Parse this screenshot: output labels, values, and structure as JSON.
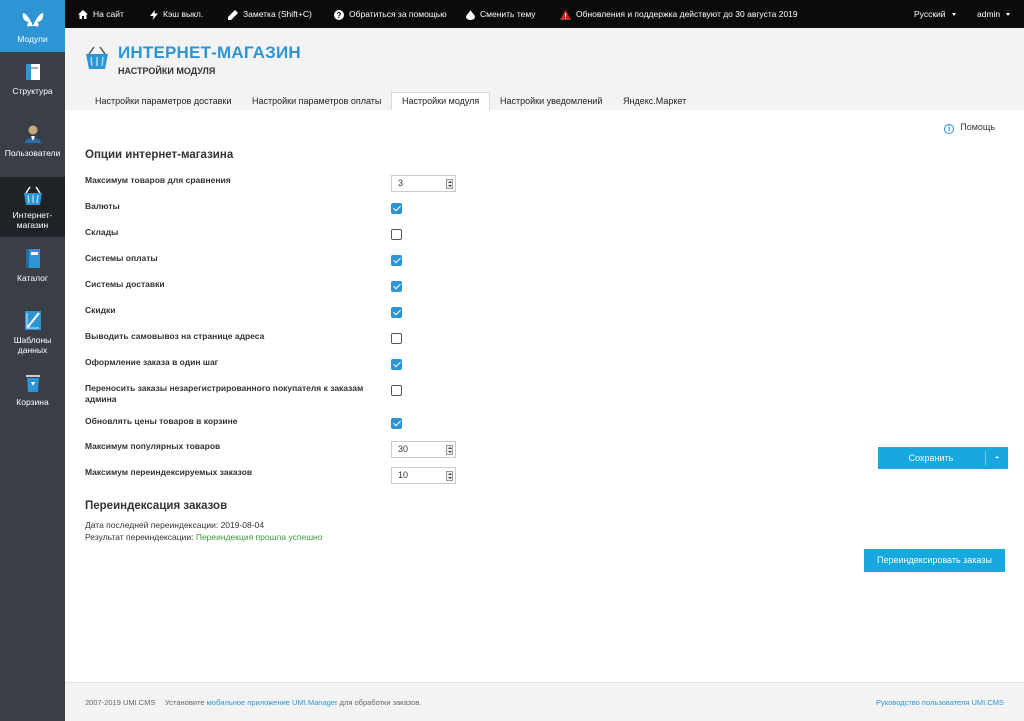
{
  "sidebar": {
    "items": [
      {
        "label": "Модули",
        "icon": "butterfly-icon"
      },
      {
        "label": "Структура",
        "icon": "structure-icon"
      },
      {
        "label": "Пользователи",
        "icon": "users-icon"
      },
      {
        "label": "Интернет-магазин",
        "icon": "shop-basket-icon"
      },
      {
        "label": "Каталог",
        "icon": "catalog-book-icon"
      },
      {
        "label": "Шаблоны данных",
        "icon": "data-templates-icon"
      },
      {
        "label": "Корзина",
        "icon": "trash-bin-icon"
      }
    ]
  },
  "topbar": {
    "site": "На сайт",
    "cache": "Кэш выкл.",
    "note": "Заметка (Shift+C)",
    "help": "Обратиться за помощью",
    "theme": "Сменить тему",
    "updates": "Обновления и поддержка действуют до 30 августа 2019",
    "language": "Русский",
    "user": "admin"
  },
  "header": {
    "title": "ИНТЕРНЕТ-МАГАЗИН",
    "subtitle": "НАСТРОЙКИ МОДУЛЯ"
  },
  "tabs": [
    {
      "label": "Настройки параметров доставки",
      "active": false
    },
    {
      "label": "Настройки параметров оплаты",
      "active": false
    },
    {
      "label": "Настройки модуля",
      "active": true
    },
    {
      "label": "Настройки уведомлений",
      "active": false
    },
    {
      "label": "Яндекс.Маркет",
      "active": false
    }
  ],
  "help_label": "Помощь",
  "options": {
    "title": "Опции интернет-магазина",
    "max_compare": {
      "label": "Максимум товаров для сравнения",
      "value": "3"
    },
    "currencies": {
      "label": "Валюты",
      "checked": true
    },
    "warehouses": {
      "label": "Склады",
      "checked": false
    },
    "payment_systems": {
      "label": "Системы оплаты",
      "checked": true
    },
    "delivery_systems": {
      "label": "Системы доставки",
      "checked": true
    },
    "discounts": {
      "label": "Скидки",
      "checked": true
    },
    "pickup_on_address": {
      "label": "Выводить самовывоз на странице адреса",
      "checked": false
    },
    "one_step_order": {
      "label": "Оформление заказа в один шаг",
      "checked": true
    },
    "transfer_orders": {
      "label": "Переносить заказы незарегистрированного покупателя к заказам админа",
      "checked": false
    },
    "update_cart_prices": {
      "label": "Обновлять цены товаров в корзине",
      "checked": true
    },
    "max_popular": {
      "label": "Максимум популярных товаров",
      "value": "30"
    },
    "max_reindex": {
      "label": "Максимум переиндексируемых заказов",
      "value": "10"
    }
  },
  "save_label": "Сохранить",
  "reindex": {
    "title": "Переиндексация заказов",
    "last_date_label": "Дата последней переиндексации:",
    "last_date_value": "2019-08-04",
    "result_label": "Результат переиндексации:",
    "result_value": "Переиндекция прошла успешно",
    "button": "Переиндексировать заказы"
  },
  "footer": {
    "copyright": "2007-2019 UMI.CMS",
    "promo_prefix": "Установите",
    "promo_link": "мобильное приложение UMI.Manager",
    "promo_suffix": "для обработки заказов.",
    "guide_link": "Руководство пользователя UMI.CMS"
  },
  "colors": {
    "accent": "#2d95d4",
    "button": "#18a8e0",
    "sidebar": "#3a3f47",
    "topbar": "#0b0b0b",
    "success": "#3a9a3a",
    "warning": "#e02020"
  }
}
